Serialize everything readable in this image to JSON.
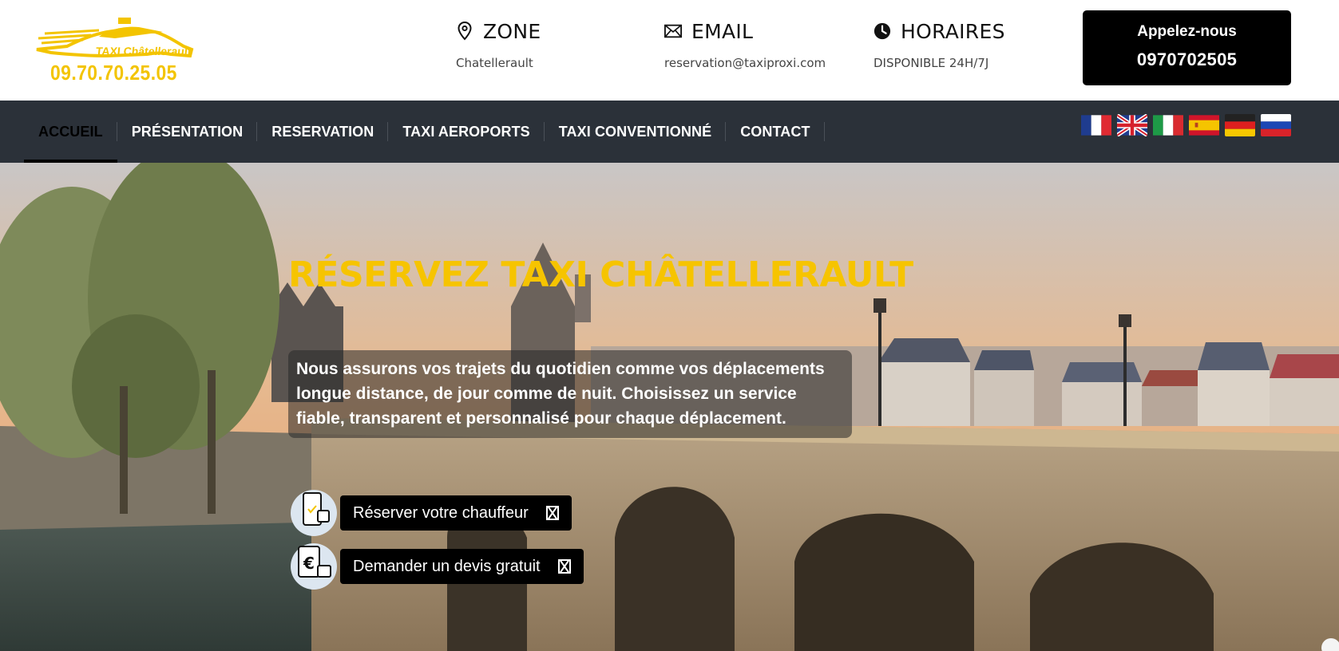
{
  "brand": {
    "logo_name": "TAXI Châtellerault",
    "logo_phone": "09.70.70.25.05",
    "accent_color": "#f6c400"
  },
  "header": {
    "zone": {
      "icon": "map-pin-icon",
      "title": "ZONE",
      "value": "Chatellerault"
    },
    "email": {
      "icon": "envelope-icon",
      "title": "EMAIL",
      "value": "reservation@taxiproxi.com"
    },
    "hours": {
      "icon": "clock-icon",
      "title": "HORAIRES",
      "value": "DISPONIBLE 24H/7J"
    },
    "call": {
      "label": "Appelez-nous",
      "number": "0970702505"
    }
  },
  "nav": {
    "items": [
      {
        "label": "ACCUEIL",
        "active": true
      },
      {
        "label": "PRÉSENTATION",
        "active": false
      },
      {
        "label": "RESERVATION",
        "active": false
      },
      {
        "label": "TAXI AEROPORTS",
        "active": false
      },
      {
        "label": "TAXI CONVENTIONNÉ",
        "active": false
      },
      {
        "label": "CONTACT",
        "active": false
      }
    ],
    "languages": [
      "flag-france-icon",
      "flag-uk-icon",
      "flag-italy-icon",
      "flag-spain-icon",
      "flag-germany-icon",
      "flag-russia-icon"
    ]
  },
  "hero": {
    "title": "RÉSERVEZ TAXI CHÂTELLERAULT",
    "text": "Nous assurons vos trajets du quotidien comme vos déplacements longue distance, de jour comme de nuit. Choisissez un service fiable, transparent et personnalisé pour chaque déplacement.",
    "cta_book": "Réserver votre chauffeur",
    "cta_quote": "Demander un devis gratuit"
  }
}
